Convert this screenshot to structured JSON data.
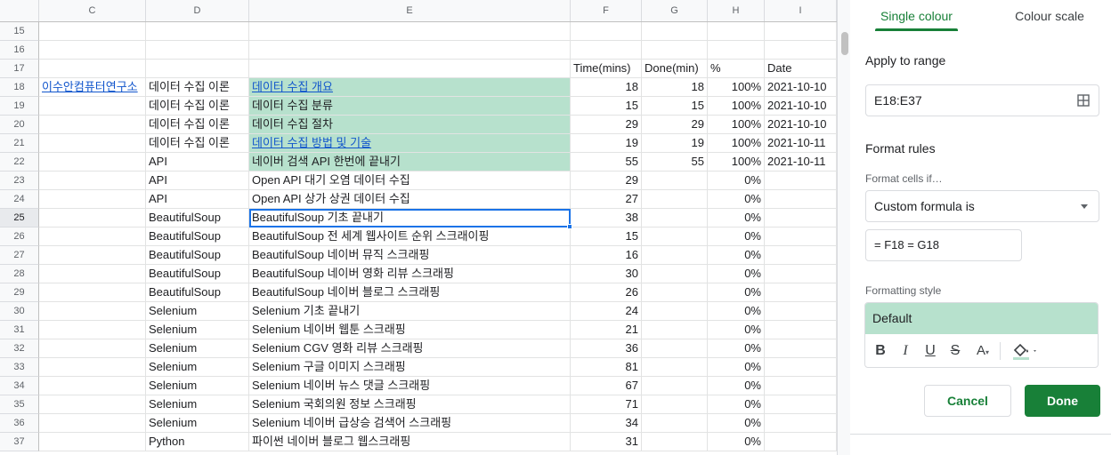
{
  "columns": [
    "C",
    "D",
    "E",
    "F",
    "G",
    "H",
    "I"
  ],
  "rows": [
    {
      "n": "15",
      "c": "",
      "d": "",
      "e": "",
      "f": "",
      "g": "",
      "h": "",
      "i": ""
    },
    {
      "n": "16",
      "c": "",
      "d": "",
      "e": "",
      "f": "",
      "g": "",
      "h": "",
      "i": ""
    },
    {
      "n": "17",
      "c": "",
      "d": "",
      "e": "",
      "f": "Time(mins)",
      "g": "Done(min)",
      "h": "%",
      "i": "Date"
    },
    {
      "n": "18",
      "c": "이수안컴퓨터연구소",
      "d": "데이터 수집 이론",
      "e": "데이터 수집 개요",
      "f": "18",
      "g": "18",
      "h": "100%",
      "i": "2021-10-10"
    },
    {
      "n": "19",
      "c": "",
      "d": "데이터 수집 이론",
      "e": "데이터 수집 분류",
      "f": "15",
      "g": "15",
      "h": "100%",
      "i": "2021-10-10"
    },
    {
      "n": "20",
      "c": "",
      "d": "데이터 수집 이론",
      "e": "데이터 수집 절차",
      "f": "29",
      "g": "29",
      "h": "100%",
      "i": "2021-10-10"
    },
    {
      "n": "21",
      "c": "",
      "d": "데이터 수집 이론",
      "e": "데이터 수집 방법 및 기술",
      "f": "19",
      "g": "19",
      "h": "100%",
      "i": "2021-10-11"
    },
    {
      "n": "22",
      "c": "",
      "d": "API",
      "e": "네이버 검색 API 한번에 끝내기",
      "f": "55",
      "g": "55",
      "h": "100%",
      "i": "2021-10-11"
    },
    {
      "n": "23",
      "c": "",
      "d": "API",
      "e": "Open API 대기 오염 데이터 수집",
      "f": "29",
      "g": "",
      "h": "0%",
      "i": ""
    },
    {
      "n": "24",
      "c": "",
      "d": "API",
      "e": "Open API 상가 상권 데이터 수집",
      "f": "27",
      "g": "",
      "h": "0%",
      "i": ""
    },
    {
      "n": "25",
      "c": "",
      "d": "BeautifulSoup",
      "e": "BeautifulSoup 기초 끝내기",
      "f": "38",
      "g": "",
      "h": "0%",
      "i": ""
    },
    {
      "n": "26",
      "c": "",
      "d": "BeautifulSoup",
      "e": "BeautifulSoup 전 세계 웹사이트 순위 스크래이핑",
      "f": "15",
      "g": "",
      "h": "0%",
      "i": ""
    },
    {
      "n": "27",
      "c": "",
      "d": "BeautifulSoup",
      "e": "BeautifulSoup 네이버 뮤직 스크래핑",
      "f": "16",
      "g": "",
      "h": "0%",
      "i": ""
    },
    {
      "n": "28",
      "c": "",
      "d": "BeautifulSoup",
      "e": "BeautifulSoup 네이버 영화 리뷰 스크래핑",
      "f": "30",
      "g": "",
      "h": "0%",
      "i": ""
    },
    {
      "n": "29",
      "c": "",
      "d": "BeautifulSoup",
      "e": "BeautifulSoup 네이버 블로그 스크래핑",
      "f": "26",
      "g": "",
      "h": "0%",
      "i": ""
    },
    {
      "n": "30",
      "c": "",
      "d": "Selenium",
      "e": "Selenium 기초 끝내기",
      "f": "24",
      "g": "",
      "h": "0%",
      "i": ""
    },
    {
      "n": "31",
      "c": "",
      "d": "Selenium",
      "e": "Selenium 네이버 웹툰 스크래핑",
      "f": "21",
      "g": "",
      "h": "0%",
      "i": ""
    },
    {
      "n": "32",
      "c": "",
      "d": "Selenium",
      "e": "Selenium CGV 영화 리뷰 스크래핑",
      "f": "36",
      "g": "",
      "h": "0%",
      "i": ""
    },
    {
      "n": "33",
      "c": "",
      "d": "Selenium",
      "e": "Selenium 구글 이미지 스크래핑",
      "f": "81",
      "g": "",
      "h": "0%",
      "i": ""
    },
    {
      "n": "34",
      "c": "",
      "d": "Selenium",
      "e": "Selenium 네이버 뉴스 댓글 스크래핑",
      "f": "67",
      "g": "",
      "h": "0%",
      "i": ""
    },
    {
      "n": "35",
      "c": "",
      "d": "Selenium",
      "e": "Selenium 국회의원 정보 스크래핑",
      "f": "71",
      "g": "",
      "h": "0%",
      "i": ""
    },
    {
      "n": "36",
      "c": "",
      "d": "Selenium",
      "e": "Selenium 네이버 급상승 검색어 스크래핑",
      "f": "34",
      "g": "",
      "h": "0%",
      "i": ""
    },
    {
      "n": "37",
      "c": "",
      "d": "Python",
      "e": "파이썬 네이버 블로그 웹스크래핑",
      "f": "31",
      "g": "",
      "h": "0%",
      "i": ""
    }
  ],
  "panel": {
    "tab_single": "Single colour",
    "tab_scale": "Colour scale",
    "apply_label": "Apply to range",
    "range_value": "E18:E37",
    "format_rules": "Format rules",
    "format_cells_if": "Format cells if…",
    "condition": "Custom formula is",
    "formula": "= F18 = G18",
    "formatting_style": "Formatting style",
    "style_name": "Default",
    "cancel": "Cancel",
    "done": "Done"
  },
  "colors": {
    "green_fill": "#b7e1cd",
    "accent": "#188038",
    "link": "#1155cc",
    "selection": "#1a73e8"
  }
}
